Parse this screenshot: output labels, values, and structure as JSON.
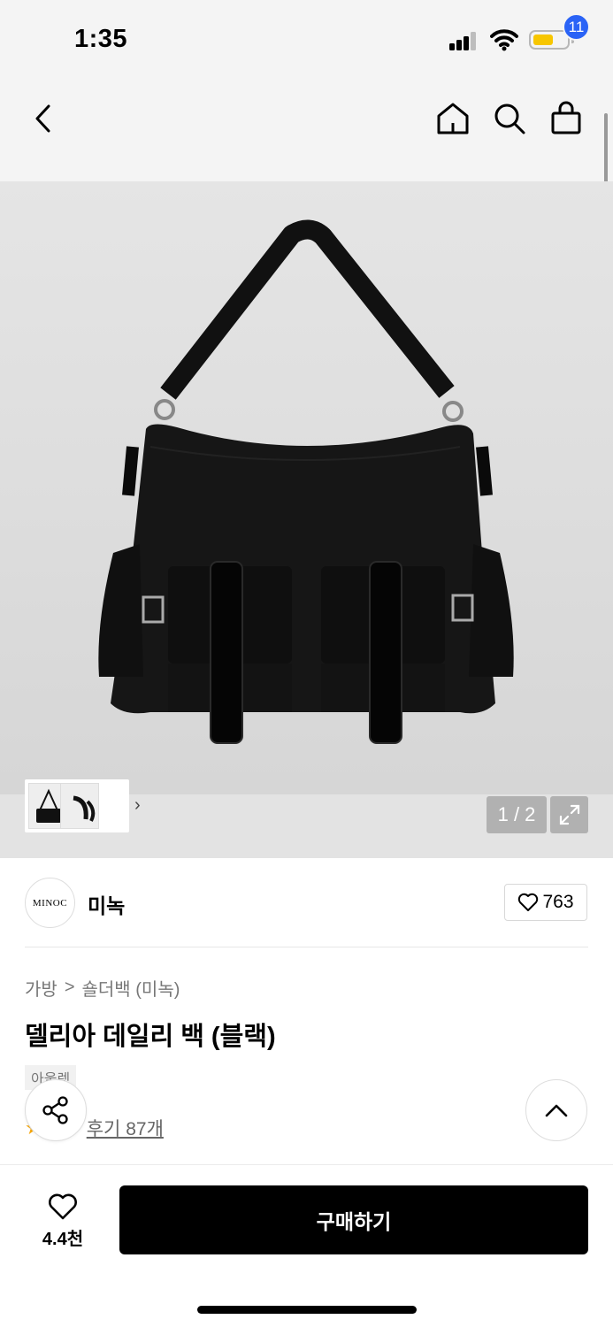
{
  "status_bar": {
    "time": "1:35"
  },
  "nav": {
    "cart_count": "11"
  },
  "gallery": {
    "counter": "1 / 2"
  },
  "brand": {
    "logo_text": "MINOC",
    "name": "미녹",
    "like_count": "763"
  },
  "breadcrumb": {
    "category": "가방",
    "separator": ">",
    "subcategory": "숄더백 (미녹)"
  },
  "product": {
    "title": "델리아 데일리 백 (블랙)",
    "tag": "아울렛",
    "rating_star": "★",
    "review_text": "후기 87개"
  },
  "bottom_bar": {
    "wish_count": "4.4천",
    "buy_label": "구매하기"
  },
  "colors": {
    "accent_badge": "#2a63f6",
    "buy_button": "#000000",
    "star": "#f7a70a",
    "battery": "#f7c600"
  },
  "icons": [
    "back-icon",
    "home-icon",
    "search-icon",
    "cart-icon",
    "expand-icon",
    "heart-icon",
    "share-icon",
    "chevron-up-icon"
  ]
}
